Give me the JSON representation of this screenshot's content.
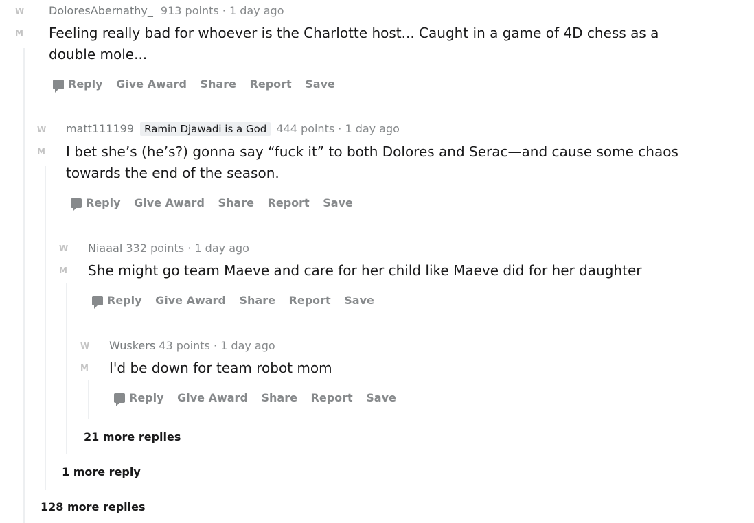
{
  "icons": {
    "upvote": "W",
    "downvote": "M"
  },
  "actions": {
    "reply": "Reply",
    "give_award": "Give Award",
    "share": "Share",
    "report": "Report",
    "save": "Save"
  },
  "comments": [
    {
      "author": "DoloresAbernathy_",
      "flair": "",
      "points": "913 points",
      "time": "· 1 day ago",
      "body": "Feeling really bad for whoever is the Charlotte host... Caught in a game of 4D chess as a double mole..."
    },
    {
      "author": "matt111199",
      "flair": "Ramin Djawadi is a God",
      "points": "444 points",
      "time": "· 1 day ago",
      "body": "I bet she’s (he’s?) gonna say “fuck it” to both Dolores and Serac—and cause some chaos towards the end of the season."
    },
    {
      "author": "Niaaal",
      "flair": "",
      "points": "332 points",
      "time": "· 1 day ago",
      "body": "She might go team Maeve and care for her child like Maeve did for her daughter"
    },
    {
      "author": "Wuskers",
      "flair": "",
      "points": "43 points",
      "time": "· 1 day ago",
      "body": "I'd be down for team robot mom"
    }
  ],
  "more": {
    "level3": "21 more replies",
    "level2": "1 more reply",
    "level1": "128 more replies"
  }
}
